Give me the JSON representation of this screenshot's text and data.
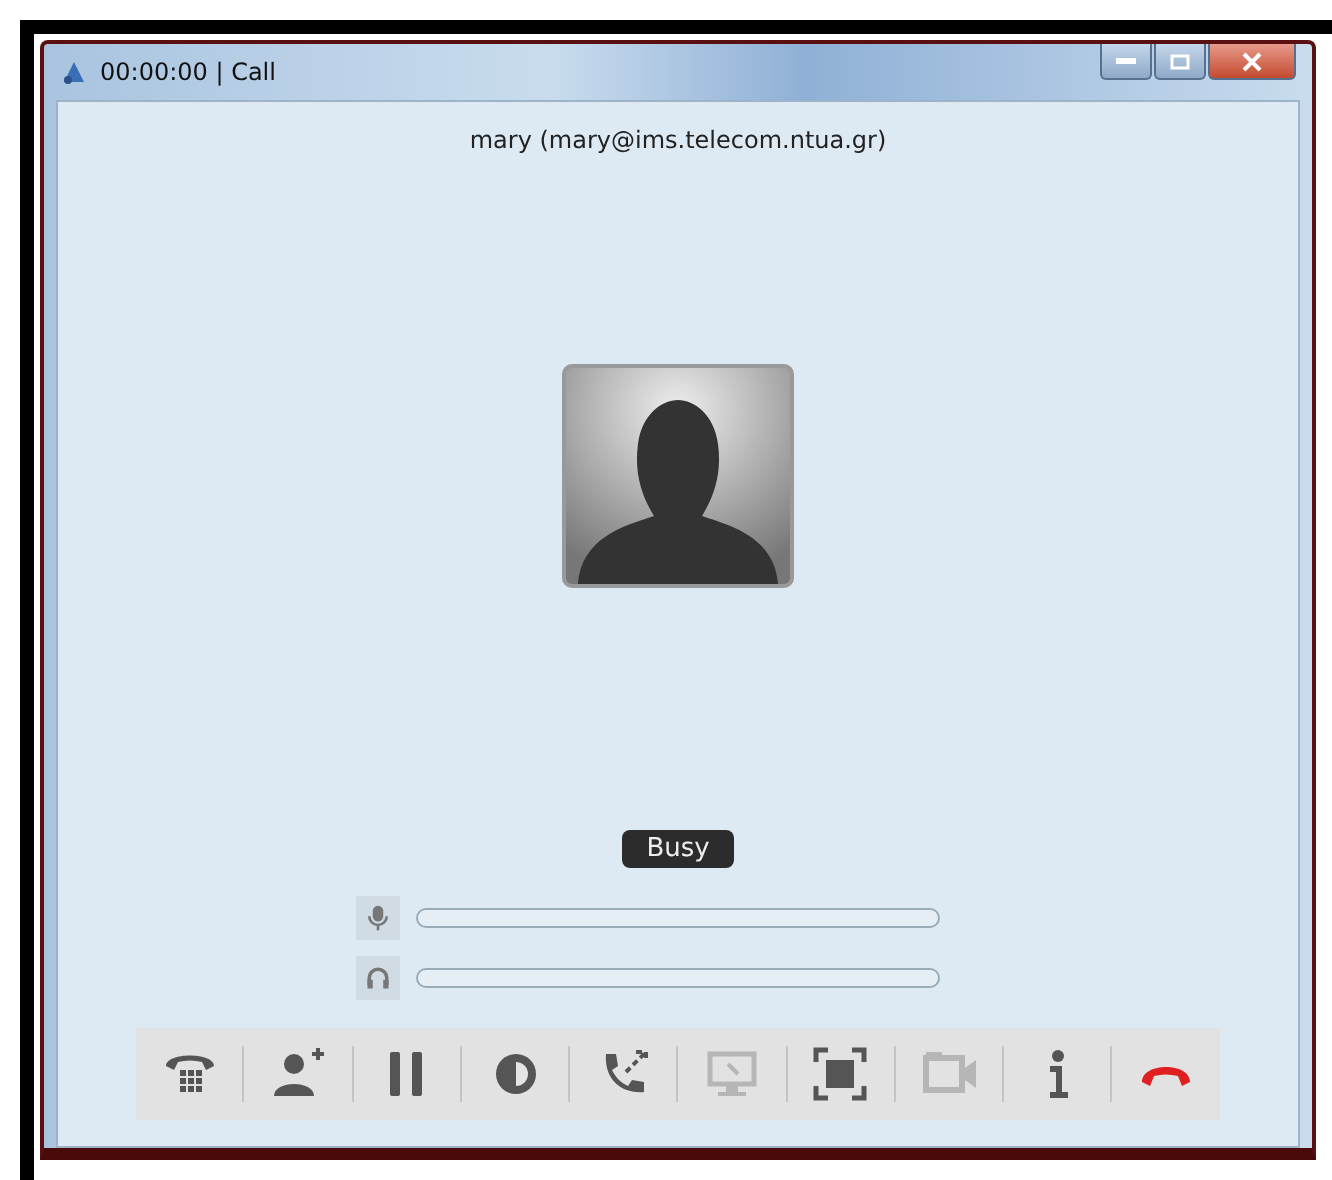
{
  "window": {
    "title": "00:00:00 | Call"
  },
  "contact": "mary (mary@ims.telecom.ntua.gr)",
  "status": "Busy",
  "meters": [
    {
      "kind": "microphone",
      "level": 0
    },
    {
      "kind": "headphones",
      "level": 0
    }
  ],
  "toolbar": [
    {
      "kind": "dialpad",
      "disabled": false
    },
    {
      "kind": "add-person",
      "disabled": false
    },
    {
      "kind": "pause",
      "disabled": false
    },
    {
      "kind": "record",
      "disabled": false
    },
    {
      "kind": "transfer",
      "disabled": false
    },
    {
      "kind": "screen",
      "disabled": true
    },
    {
      "kind": "fullscreen",
      "disabled": false
    },
    {
      "kind": "video",
      "disabled": true
    },
    {
      "kind": "info",
      "disabled": false
    },
    {
      "kind": "hangup",
      "disabled": false
    }
  ]
}
